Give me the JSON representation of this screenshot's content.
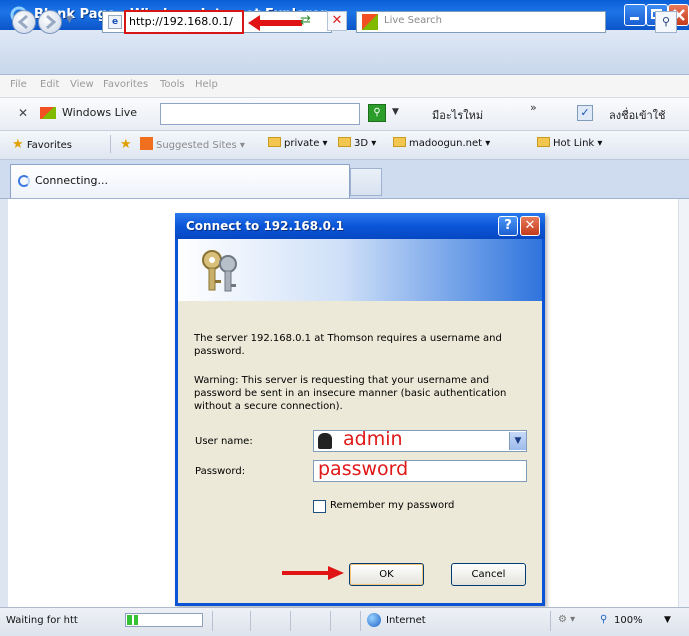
{
  "window": {
    "title": "Blank Page - Windows Internet Explorer"
  },
  "address_bar": {
    "url": "http://192.168.0.1/",
    "search_placeholder": "Live Search"
  },
  "menu": [
    "File",
    "Edit",
    "View",
    "Favorites",
    "Tools",
    "Help"
  ],
  "windows_live_bar": {
    "label": "Windows Live",
    "new_label": "มีอะไรใหม่",
    "more_label": "»",
    "signin_label": "ลงชื่อเข้าใช้"
  },
  "favorites_bar": {
    "favorites_label": "Favorites",
    "items": [
      "Suggested Sites ▾",
      "private ▾",
      "3D ▾",
      "madoogun.net ▾",
      "Hot Link ▾"
    ]
  },
  "tab": {
    "label": "Connecting..."
  },
  "dialog": {
    "title": "Connect to 192.168.0.1",
    "message": "The server 192.168.0.1 at Thomson requires a username and password.",
    "warning": "Warning: This server is requesting that your username and password be sent in an insecure manner (basic authentication without a secure connection).",
    "username_label": "User name:",
    "username_value": "admin",
    "password_label": "Password:",
    "password_value": "password",
    "remember_label": "Remember my password",
    "remember_checked": false,
    "ok_label": "OK",
    "cancel_label": "Cancel"
  },
  "status_bar": {
    "status_text": "Waiting for htt",
    "progress_fraction": 0.15,
    "zone": "Internet",
    "zoom": "100%"
  },
  "colors": {
    "titlebar_blue": "#0a5fd6",
    "annotation_red": "#d61616",
    "dialog_face": "#ece9d8"
  }
}
